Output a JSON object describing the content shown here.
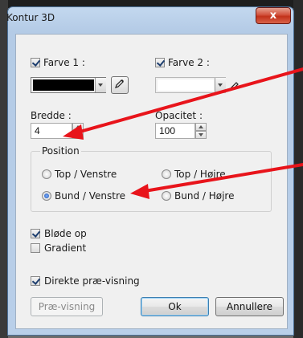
{
  "window": {
    "title": "Kontur 3D",
    "close_glyph": "x"
  },
  "colors": {
    "accent_arrow": "#e8141b",
    "farve1_value": "#000000",
    "farve2_value": "#ffffff"
  },
  "farve1": {
    "label": "Farve 1 :",
    "checked": true
  },
  "farve2": {
    "label": "Farve 2 :",
    "checked": true
  },
  "bredde": {
    "label": "Bredde :",
    "value": "4"
  },
  "opacitet": {
    "label": "Opacitet :",
    "value": "100"
  },
  "position": {
    "legend": "Position",
    "options": [
      {
        "label": "Top / Venstre",
        "selected": false
      },
      {
        "label": "Top / Højre",
        "selected": false
      },
      {
        "label": "Bund / Venstre",
        "selected": true
      },
      {
        "label": "Bund / Højre",
        "selected": false
      }
    ]
  },
  "checkboxes": {
    "blode_op": {
      "label": "Bløde op",
      "checked": true
    },
    "gradient": {
      "label": "Gradient",
      "checked": false
    },
    "direkte": {
      "label": "Direkte præ-visning",
      "checked": true
    }
  },
  "buttons": {
    "preview": "Præ-visning",
    "ok": "Ok",
    "cancel": "Annullere"
  },
  "icons": {
    "eyedropper": "eyedropper-icon"
  }
}
